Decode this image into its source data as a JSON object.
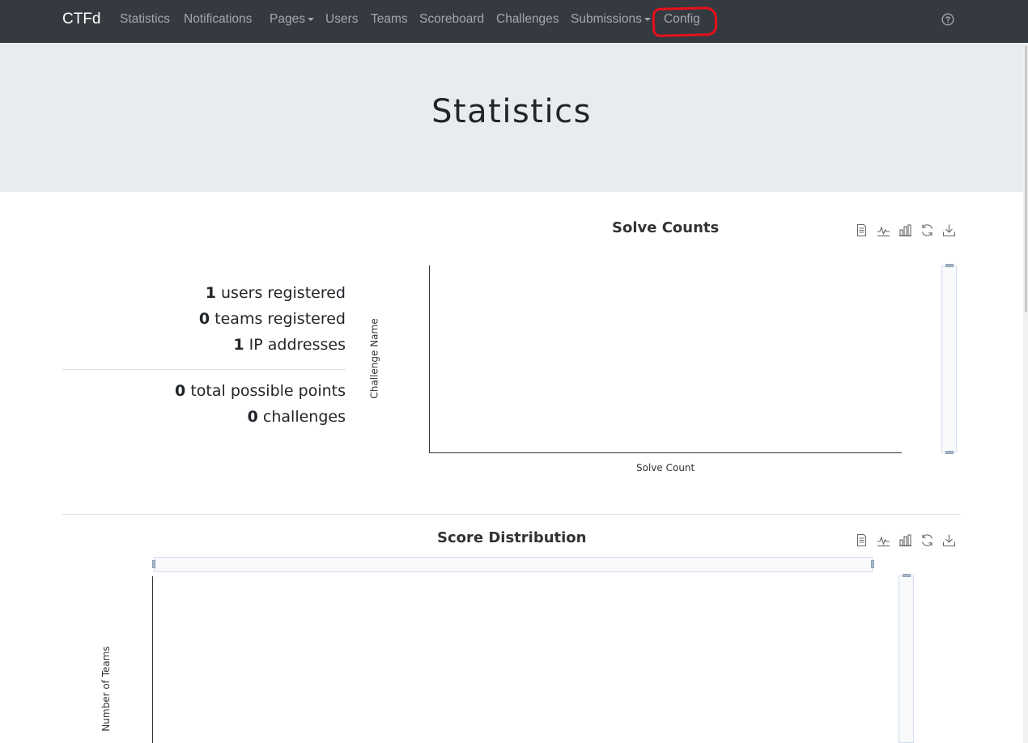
{
  "navbar": {
    "brand": "CTFd",
    "items": [
      {
        "label": "Statistics"
      },
      {
        "label": "Notifications"
      },
      {
        "label": "Pages"
      },
      {
        "label": "Users"
      },
      {
        "label": "Teams"
      },
      {
        "label": "Scoreboard"
      },
      {
        "label": "Challenges"
      },
      {
        "label": "Submissions"
      },
      {
        "label": "Config"
      }
    ],
    "help_icon": "question-circle-icon"
  },
  "header": {
    "title": "Statistics"
  },
  "stats": {
    "users": {
      "count": "1",
      "label": "users registered"
    },
    "teams": {
      "count": "0",
      "label": "teams registered"
    },
    "ips": {
      "count": "1",
      "label": "IP addresses"
    },
    "points": {
      "count": "0",
      "label": "total possible points"
    },
    "challenges": {
      "count": "0",
      "label": "challenges"
    }
  },
  "colors": {
    "navbar_bg": "#343a40",
    "jumbotron_bg": "#e9ecef",
    "annotation": "#e8101a"
  },
  "toolbox_icons": [
    "data-view-icon",
    "line-chart-icon",
    "bar-chart-icon",
    "restore-icon",
    "download-icon"
  ],
  "chart_data": [
    {
      "type": "bar",
      "title": "Solve Counts",
      "xlabel": "Solve Count",
      "ylabel": "Challenge Name",
      "categories": [],
      "values": []
    },
    {
      "type": "bar",
      "title": "Score Distribution",
      "xlabel": "",
      "ylabel": "Number of Teams",
      "categories": [],
      "values": []
    }
  ]
}
